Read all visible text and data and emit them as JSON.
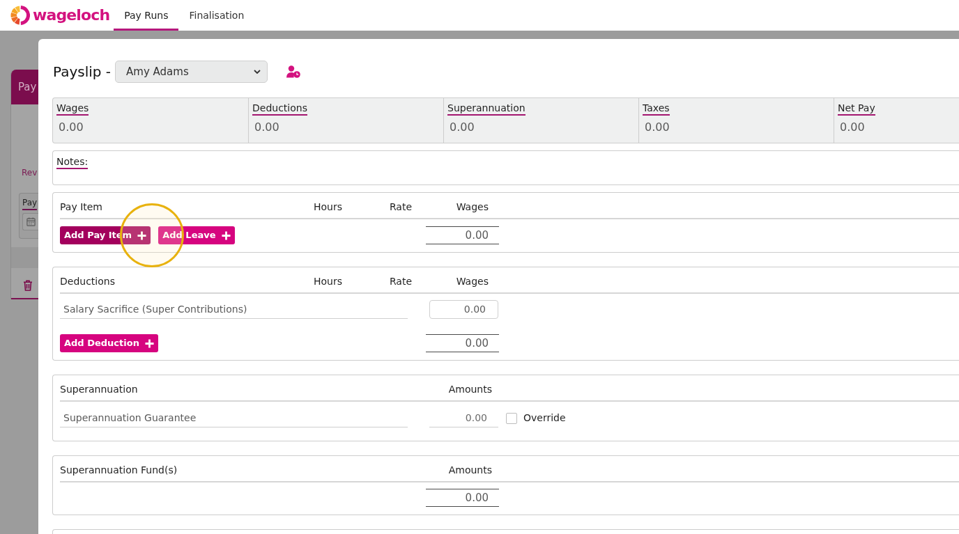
{
  "app_bar": {
    "logo_text": "wageloch",
    "tabs": [
      {
        "label": "Pay Runs",
        "selected": true
      },
      {
        "label": "Finalisation",
        "selected": false
      }
    ]
  },
  "background_card": {
    "title": "Pay",
    "link": "Rev",
    "field_label": "Pay"
  },
  "payslip": {
    "title": "Payslip -",
    "employee_select": {
      "value": "Amy Adams"
    },
    "summary": [
      {
        "label": "Wages",
        "value": "0.00"
      },
      {
        "label": "Deductions",
        "value": "0.00"
      },
      {
        "label": "Superannuation",
        "value": "0.00"
      },
      {
        "label": "Taxes",
        "value": "0.00"
      },
      {
        "label": "Net Pay",
        "value": "0.00"
      }
    ],
    "notes": {
      "label": "Notes:"
    },
    "sections": [
      {
        "kind": "wage_table",
        "columns": [
          "Pay Item",
          "Hours",
          "Rate",
          "Wages"
        ],
        "buttons": [
          {
            "label": "Add Pay Item",
            "pressed": true
          },
          {
            "label": "Add Leave",
            "pressed": false
          }
        ],
        "total": "0.00"
      },
      {
        "kind": "wage_table",
        "columns": [
          "Deductions",
          "Hours",
          "Rate",
          "Wages"
        ],
        "rows": [
          {
            "name": "Salary Sacrifice (Super Contributions)",
            "amount": "0.00"
          }
        ],
        "buttons": [
          {
            "label": "Add Deduction",
            "pressed": false
          }
        ],
        "total": "0.00"
      },
      {
        "kind": "amount_table",
        "columns": [
          "Superannuation",
          "Amounts"
        ],
        "rows": [
          {
            "name": "Superannuation Guarantee",
            "amount": "0.00",
            "override_label": "Override",
            "override": false
          }
        ]
      },
      {
        "kind": "amount_table",
        "columns": [
          "Superannuation Fund(s)",
          "Amounts"
        ],
        "total": "0.00"
      }
    ]
  }
}
